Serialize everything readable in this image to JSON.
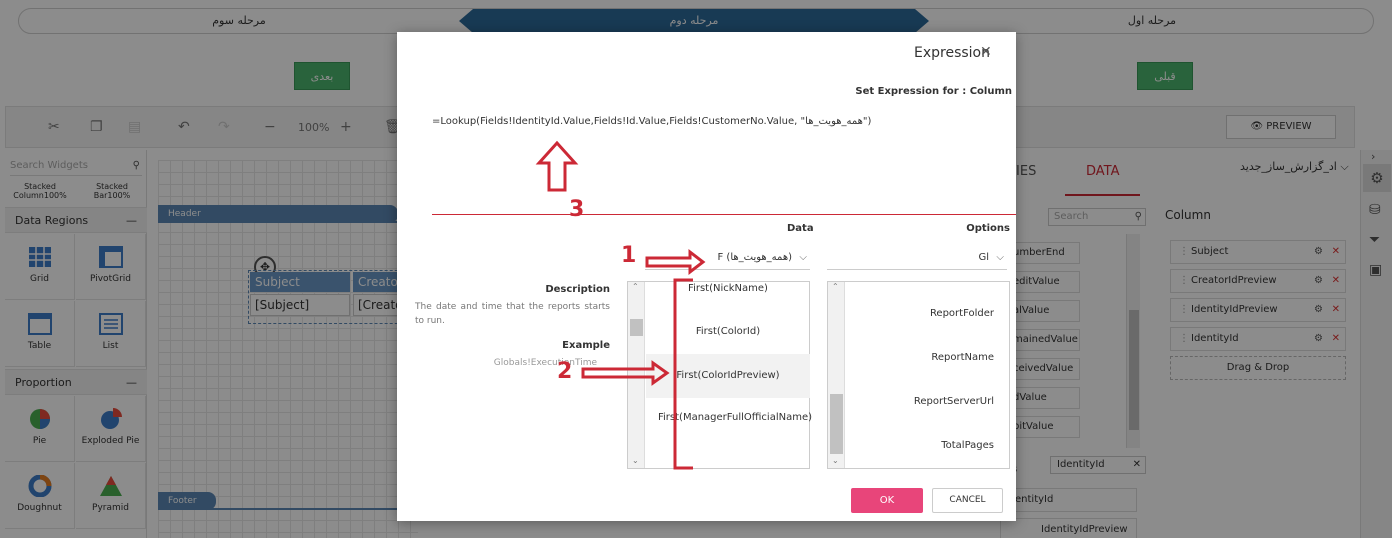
{
  "stepper": {
    "step1": "مرحله اول",
    "step2": "مرحله دوم",
    "step3": "مرحله سوم"
  },
  "nav": {
    "prev": "قبلی",
    "next": "بعدی"
  },
  "toolbar": {
    "zoom": "100%",
    "preview": "PREVIEW"
  },
  "left_panel": {
    "search_placeholder": "Search Widgets",
    "stacked1": "Stacked Column100%",
    "stacked2": "Stacked Bar100%",
    "section_data_regions": "Data Regions",
    "grid": "Grid",
    "pivot": "PivotGrid",
    "table": "Table",
    "list": "List",
    "section_proportion": "Proportion",
    "pie": "Pie",
    "exploded_pie": "Exploded Pie",
    "doughnut": "Doughnut",
    "pyramid": "Pyramid"
  },
  "canvas": {
    "header_band": "Header",
    "footer_band": "Footer",
    "col_subject": "Subject",
    "col_creator": "Creato",
    "cell_subject": "[Subject]",
    "cell_creator": "[Creato"
  },
  "right_panel": {
    "tab_properties": "RTIES",
    "tab_data": "DATA",
    "dataset": "اد_گزارش_ساز_جدید",
    "search_placeholder": "Search",
    "column_title": "Column",
    "fields": [
      "umberEnd",
      "editValue",
      "alValue",
      "mainedValue",
      "ceivedValue",
      "dValue",
      "bitValue"
    ],
    "columns": [
      "Subject",
      "CreatorIdPreview",
      "IdentityIdPreview",
      "IdentityId"
    ],
    "drag_drop": "Drag & Drop",
    "filter_prefix": "s",
    "filter_value": "IdentityId",
    "bottom_items": [
      "entityId",
      "IdentityIdPreview"
    ]
  },
  "modal": {
    "title": "Expression",
    "subtitle": "Set Expression for : Column",
    "expression": "=Lookup(Fields!IdentityId.Value,Fields!Id.Value,Fields!CustomerNo.Value, \"همه_هویت_ها\")",
    "data_label": "Data",
    "options_label": "Options",
    "data_select": "F (همه_هویت_ها)",
    "options_select": "Gl",
    "description_label": "Description",
    "description_text": "The date and time that the reports starts to run.",
    "example_label": "Example",
    "example_text": "Globals!ExecutionTime",
    "data_items": [
      "First(NickName)",
      "First(ColorId)",
      "First(ColorIdPreview)",
      "First(ManagerFullOfficialName)"
    ],
    "options_items": [
      "ReportFolder",
      "ReportName",
      "ReportServerUrl",
      "TotalPages"
    ],
    "ok": "OK",
    "cancel": "CANCEL"
  },
  "annotations": {
    "n1": "1",
    "n2": "2",
    "n3": "3"
  }
}
